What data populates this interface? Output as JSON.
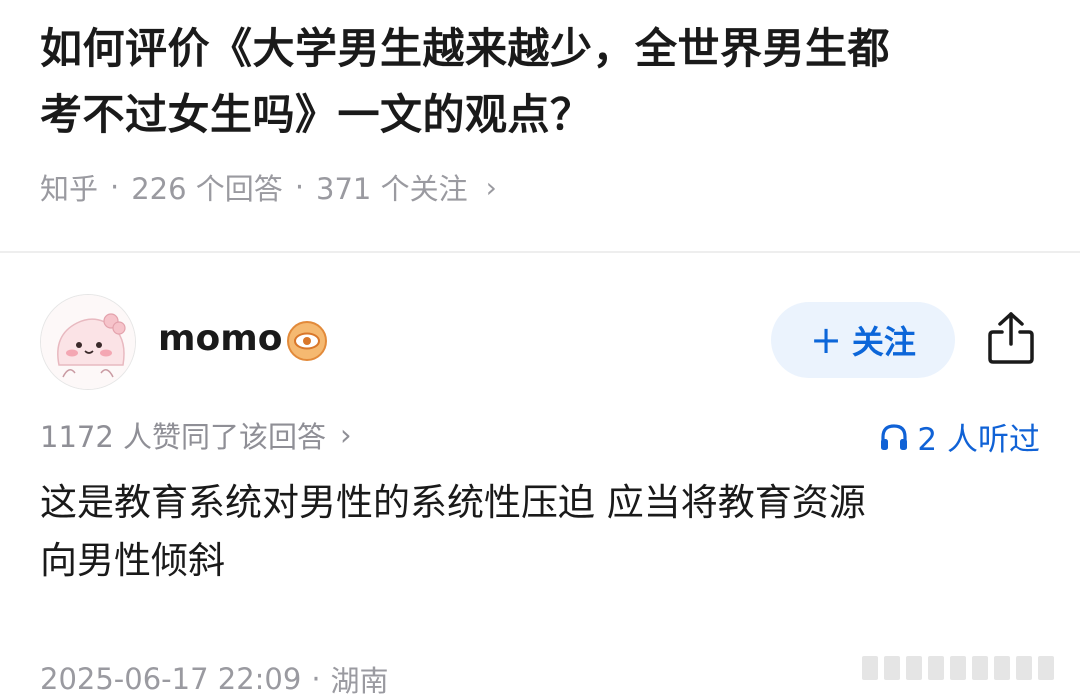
{
  "question": {
    "title_line1": "如何评价《大学男生越来越少，全世界男生都",
    "title_line2": "考不过女生吗》一文的观点？",
    "source": "知乎",
    "answers": "226 个回答",
    "followers": "371 个关注"
  },
  "answer": {
    "author": "momo",
    "follow_label": "关注",
    "likes_text": "1172 人赞同了该回答",
    "listened_text": "2 人听过",
    "content_line1": "这是教育系统对男性的系统性压迫 应当将教育资源",
    "content_line2": "向男性倾斜",
    "timestamp": "2025-06-17 22:09",
    "location": "湖南"
  },
  "colors": {
    "accent": "#0c66d9",
    "follow_bg": "#ebf3fd",
    "meta": "#9a9aa0",
    "badge": "#f0a050"
  }
}
